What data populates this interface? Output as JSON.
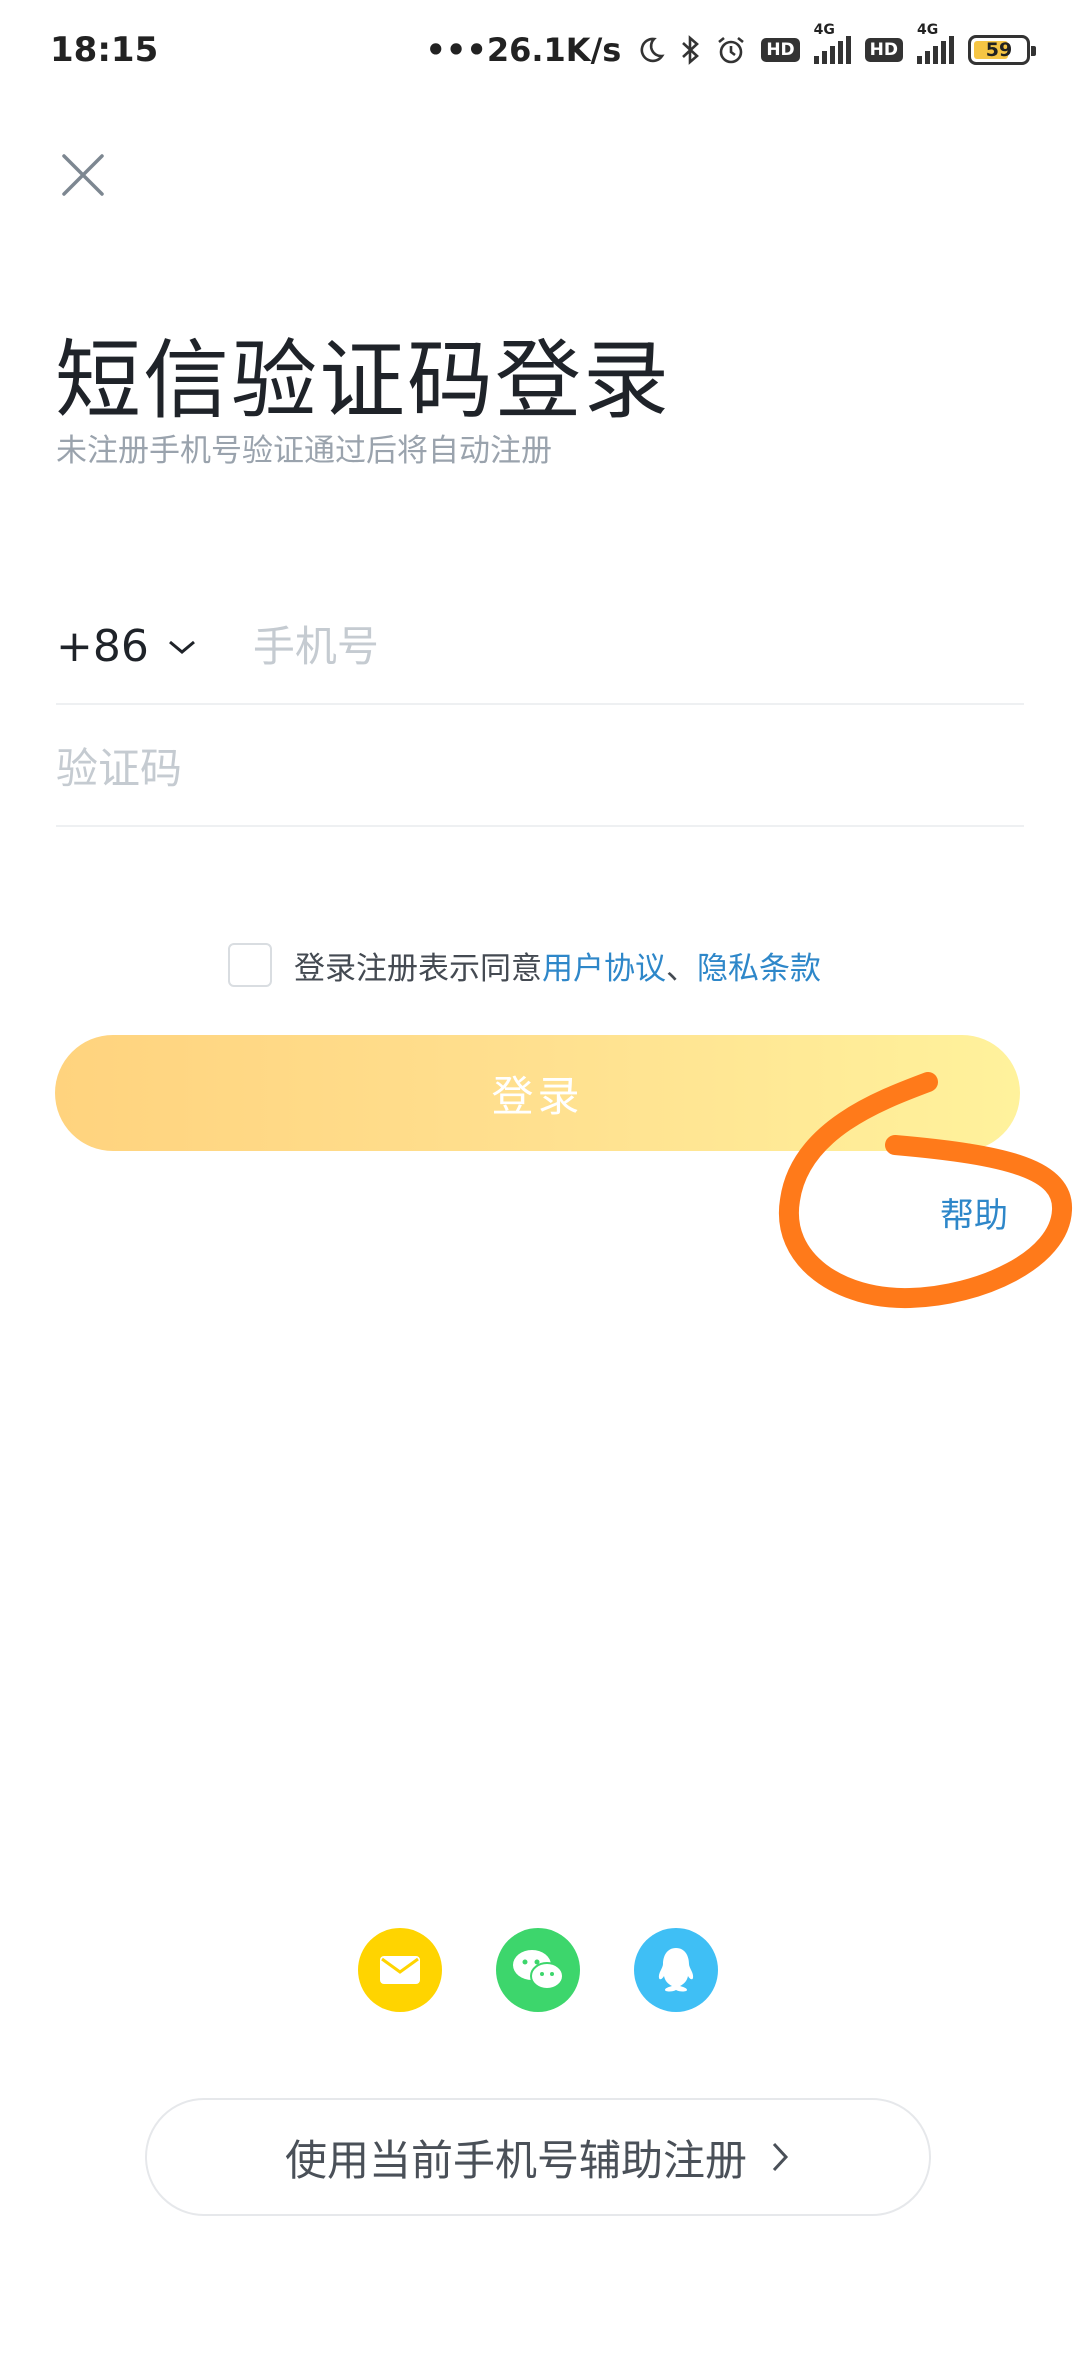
{
  "status_bar": {
    "time": "18:15",
    "net_speed": "•••26.1K/s",
    "hd_label": "HD",
    "network_type": "4G",
    "battery_level": "59"
  },
  "header": {
    "title": "短信验证码登录",
    "subtitle": "未注册手机号验证通过后将自动注册"
  },
  "form": {
    "country_code": "+86",
    "phone_placeholder": "手机号",
    "code_placeholder": "验证码"
  },
  "agreement": {
    "prefix": "登录注册表示同意",
    "user_agreement": "用户协议",
    "separator": "、",
    "privacy_policy": "隐私条款",
    "checked": false
  },
  "login_button": {
    "label": "登录"
  },
  "help_link": {
    "label": "帮助"
  },
  "social_login": [
    {
      "icon": "mail-icon",
      "color": "#ffd400"
    },
    {
      "icon": "wechat-icon",
      "color": "#3dd66c"
    },
    {
      "icon": "qq-icon",
      "color": "#3fbff5"
    }
  ],
  "assist_button": {
    "label": "使用当前手机号辅助注册",
    "icon": "chevron-right-icon"
  },
  "colors": {
    "accent_link": "#2e87c9",
    "button_gradient_start": "#ffd37e",
    "button_gradient_end": "#fff29c",
    "annotation_orange": "#ff7a1a"
  }
}
